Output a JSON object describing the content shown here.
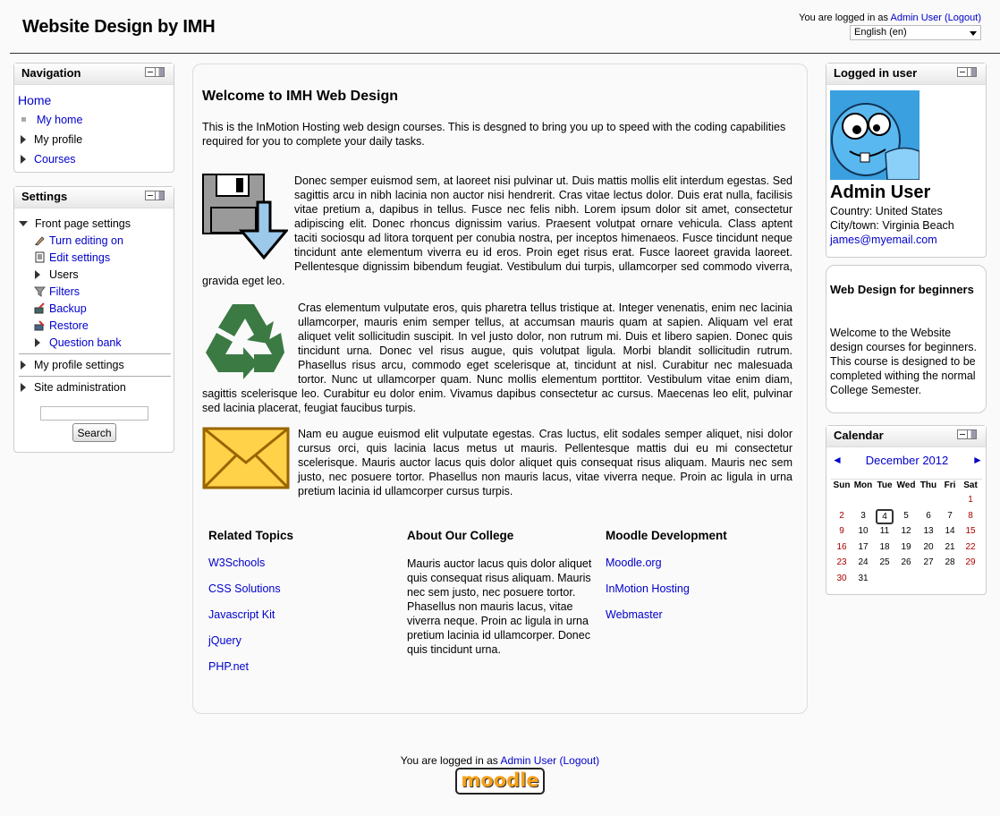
{
  "header": {
    "site_title": "Website Design by IMH",
    "logged_in_prefix": "You are logged in as",
    "user_name": "Admin User",
    "logout": "(Logout)",
    "language": "English (en)"
  },
  "navigation": {
    "title": "Navigation",
    "home": "Home",
    "my_home": "My home",
    "my_profile": "My profile",
    "courses": "Courses"
  },
  "settings": {
    "title": "Settings",
    "front_page": "Front page settings",
    "turn_editing": "Turn editing on",
    "edit_settings": "Edit settings",
    "users": "Users",
    "filters": "Filters",
    "backup": "Backup",
    "restore": "Restore",
    "question_bank": "Question bank",
    "my_profile_settings": "My profile settings",
    "site_admin": "Site administration",
    "search_button": "Search"
  },
  "main": {
    "heading": "Welcome to IMH Web Design",
    "intro": "This is the InMotion Hosting web design courses. This is desgned to bring you up to speed with the coding capabilities required for you to complete your daily tasks.",
    "para1": "Donec semper euismod sem, at laoreet nisi pulvinar ut. Duis mattis mollis elit interdum egestas. Sed sagittis arcu in nibh lacinia non auctor nisi hendrerit. Cras vitae lectus dolor. Duis erat nulla, facilisis vitae pretium a, dapibus in tellus. Fusce nec felis nibh. Lorem ipsum dolor sit amet, consectetur adipiscing elit. Donec rhoncus dignissim varius. Praesent volutpat ornare vehicula. Class aptent taciti sociosqu ad litora torquent per conubia nostra, per inceptos himenaeos. Fusce tincidunt neque tincidunt ante elementum viverra eu id eros. Proin eget risus erat. Fusce laoreet gravida laoreet. Pellentesque dignissim bibendum feugiat. Vestibulum dui turpis, ullamcorper sed commodo viverra, gravida eget leo.",
    "para2": "Cras elementum vulputate eros, quis pharetra tellus tristique at. Integer venenatis, enim nec lacinia ullamcorper, mauris enim semper tellus, at accumsan mauris quam at sapien. Aliquam vel erat aliquet velit sollicitudin suscipit. In vel justo dolor, non rutrum mi. Duis et libero sapien. Donec quis tincidunt urna. Donec vel risus augue, quis volutpat ligula. Morbi blandit sollicitudin rutrum. Phasellus risus arcu, commodo eget scelerisque at, tincidunt at nisl. Curabitur nec malesuada tortor. Nunc ut ullamcorper quam. Nunc mollis elementum porttitor. Vestibulum vitae enim diam, sagittis scelerisque leo. Curabitur eu dolor enim. Vivamus dapibus consectetur ac cursus. Maecenas leo elit, pulvinar sed lacinia placerat, feugiat faucibus turpis.",
    "para3": "Nam eu augue euismod elit vulputate egestas. Cras luctus, elit sodales semper aliquet, nisi dolor cursus orci, quis lacinia lacus metus ut mauris. Pellentesque mattis dui eu mi consectetur scelerisque. Mauris auctor lacus quis dolor aliquet quis consequat risus aliquam. Mauris nec sem justo, nec posuere tortor. Phasellus non mauris lacus, vitae viverra neque. Proin ac ligula in urna pretium lacinia id ullamcorper cursus turpis.",
    "related_title": "Related Topics",
    "related_links": [
      "W3Schools",
      "CSS Solutions",
      "Javascript Kit",
      "jQuery",
      "PHP.net"
    ],
    "about_title": "About Our College",
    "about_text": "Mauris auctor lacus quis dolor aliquet quis consequat risus aliquam. Mauris nec sem justo, nec posuere tortor. Phasellus non mauris lacus, vitae viverra neque. Proin ac ligula in urna pretium lacinia id ullamcorper. Donec quis tincidunt urna.",
    "moodle_title": "Moodle Development",
    "moodle_links": [
      "Moodle.org",
      "InMotion Hosting",
      "Webmaster"
    ]
  },
  "logged_in_block": {
    "title": "Logged in user",
    "name": "Admin User",
    "country": "Country: United States",
    "city": "City/town: Virginia Beach",
    "email": "james@myemail.com"
  },
  "course_block": {
    "title": "Web Design for beginners",
    "text": "Welcome to the Website design courses for beginners. This course is designed to be completed withing the normal College Semester."
  },
  "calendar": {
    "title": "Calendar",
    "prev": "◄",
    "next": "►",
    "month": "December 2012",
    "days": [
      "Sun",
      "Mon",
      "Tue",
      "Wed",
      "Thu",
      "Fri",
      "Sat"
    ],
    "weeks": [
      [
        "",
        "",
        "",
        "",
        "",
        "",
        "1"
      ],
      [
        "2",
        "3",
        "4",
        "5",
        "6",
        "7",
        "8"
      ],
      [
        "9",
        "10",
        "11",
        "12",
        "13",
        "14",
        "15"
      ],
      [
        "16",
        "17",
        "18",
        "19",
        "20",
        "21",
        "22"
      ],
      [
        "23",
        "24",
        "25",
        "26",
        "27",
        "28",
        "29"
      ],
      [
        "30",
        "31",
        "",
        "",
        "",
        "",
        ""
      ]
    ],
    "today": "4"
  },
  "footer": {
    "logged_in_prefix": "You are logged in as",
    "user_name": "Admin User",
    "logout": "(Logout)",
    "logo_text": "moodle"
  }
}
